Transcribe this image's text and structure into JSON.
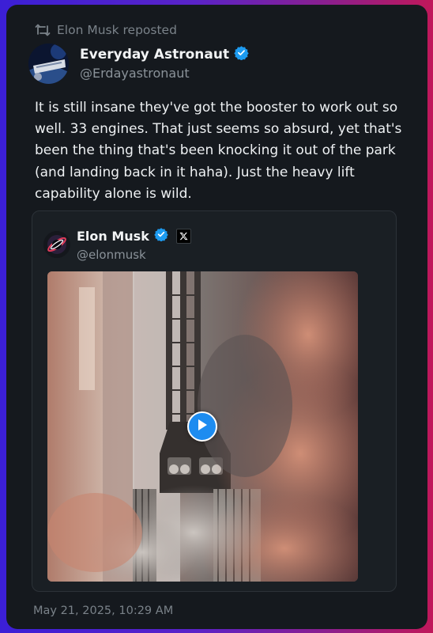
{
  "repost": {
    "label": "Elon Musk reposted"
  },
  "author": {
    "name": "Everyday Astronaut",
    "handle": "@Erdayastronaut"
  },
  "tweet": {
    "text": "It is still insane they've got the booster to work out so well. 33 engines. That just seems so absurd, yet that's been the thing that's been knocking it out of the park (and landing back in it haha). Just the heavy lift capability alone is wild."
  },
  "quoted": {
    "name": "Elon Musk",
    "handle": "@elonmusk"
  },
  "timestamp": "May 21, 2025, 10:29 AM",
  "colors": {
    "card": "#15191e",
    "verified": "#1d9bf0",
    "play": "#1d8cf0",
    "muted": "#7a8289"
  },
  "icons": {
    "repost": "repost-icon",
    "verified": "verified-badge-icon",
    "x": "x-logo-icon",
    "play": "play-icon"
  }
}
